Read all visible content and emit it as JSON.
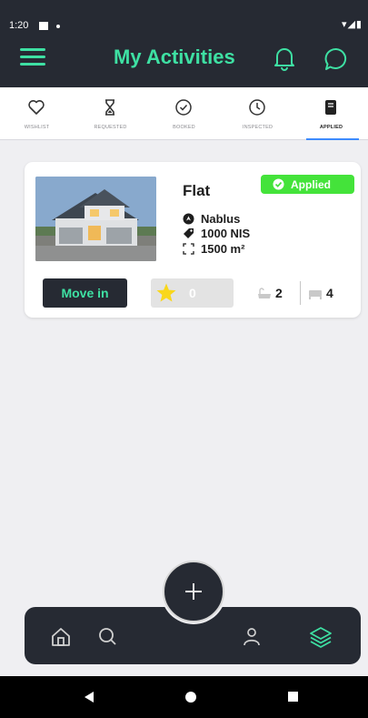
{
  "status_bar": {
    "time": "1:20",
    "right_icons": "▾◢▮"
  },
  "header": {
    "title": "My Activities"
  },
  "tabs": [
    {
      "label": "WISHLIST",
      "icon": "heart-icon"
    },
    {
      "label": "REQUESTED",
      "icon": "hourglass-icon"
    },
    {
      "label": "BOOKED",
      "icon": "check-circle-icon"
    },
    {
      "label": "INSPECTED",
      "icon": "clock-icon"
    },
    {
      "label": "APPLIED",
      "icon": "document-icon",
      "active": true
    }
  ],
  "card": {
    "type": "Flat",
    "badge": "Applied",
    "location": "Nablus",
    "price": "1000 NIS",
    "area": "1500 m²",
    "move_in_label": "Move in",
    "rating": "0",
    "bathrooms": "2",
    "bedrooms": "4"
  },
  "colors": {
    "accent": "#3ee0a3",
    "dark": "#262a33",
    "applied": "#44e33a",
    "tab_indicator": "#3d8bfd",
    "star": "#f9d71c"
  },
  "bottom_nav": [
    "home-icon",
    "search-icon",
    "add-icon",
    "profile-icon",
    "layers-icon"
  ]
}
